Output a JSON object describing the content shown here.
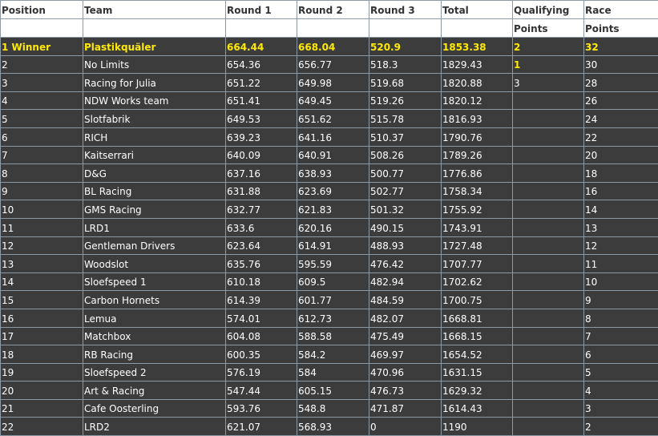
{
  "headers": {
    "position": "Position",
    "team": "Team",
    "round1": "Round 1",
    "round2": "Round 2",
    "round3": "Round 3",
    "total": "Total",
    "qualifying_top": "Qualifying",
    "qualifying_bottom": "Points",
    "race_top": "Race",
    "race_bottom": "Points"
  },
  "rows": [
    {
      "pos": "1  Winner",
      "team": "Plastikquäler",
      "r1": "664.44",
      "r2": "668.04",
      "r3": "520.9",
      "total": "1853.38",
      "qual": "2",
      "race": "32"
    },
    {
      "pos": "2",
      "team": "No Limits",
      "r1": "654.36",
      "r2": "656.77",
      "r3": "518.3",
      "total": "1829.43",
      "qual": "1",
      "race": "30"
    },
    {
      "pos": "3",
      "team": "Racing for Julia",
      "r1": "651.22",
      "r2": "649.98",
      "r3": "519.68",
      "total": "1820.88",
      "qual": "3",
      "race": "28"
    },
    {
      "pos": "4",
      "team": "NDW Works team",
      "r1": "651.41",
      "r2": "649.45",
      "r3": "519.26",
      "total": "1820.12",
      "qual": "",
      "race": "26"
    },
    {
      "pos": "5",
      "team": "Slotfabrik",
      "r1": "649.53",
      "r2": "651.62",
      "r3": "515.78",
      "total": "1816.93",
      "qual": "",
      "race": "24"
    },
    {
      "pos": "6",
      "team": "RICH",
      "r1": "639.23",
      "r2": "641.16",
      "r3": "510.37",
      "total": "1790.76",
      "qual": "",
      "race": "22"
    },
    {
      "pos": "7",
      "team": "Kaitserrari",
      "r1": "640.09",
      "r2": "640.91",
      "r3": "508.26",
      "total": "1789.26",
      "qual": "",
      "race": "20"
    },
    {
      "pos": "8",
      "team": "D&G",
      "r1": "637.16",
      "r2": "638.93",
      "r3": "500.77",
      "total": "1776.86",
      "qual": "",
      "race": "18"
    },
    {
      "pos": "9",
      "team": "BL Racing",
      "r1": "631.88",
      "r2": "623.69",
      "r3": "502.77",
      "total": "1758.34",
      "qual": "",
      "race": "16"
    },
    {
      "pos": "10",
      "team": "GMS Racing",
      "r1": "632.77",
      "r2": "621.83",
      "r3": "501.32",
      "total": "1755.92",
      "qual": "",
      "race": "14"
    },
    {
      "pos": "11",
      "team": "LRD1",
      "r1": "633.6",
      "r2": "620.16",
      "r3": "490.15",
      "total": "1743.91",
      "qual": "",
      "race": "13"
    },
    {
      "pos": "12",
      "team": "Gentleman Drivers",
      "r1": "623.64",
      "r2": "614.91",
      "r3": "488.93",
      "total": "1727.48",
      "qual": "",
      "race": "12"
    },
    {
      "pos": "13",
      "team": "Woodslot",
      "r1": "635.76",
      "r2": "595.59",
      "r3": "476.42",
      "total": "1707.77",
      "qual": "",
      "race": "11"
    },
    {
      "pos": "14",
      "team": "Sloefspeed 1",
      "r1": "610.18",
      "r2": "609.5",
      "r3": "482.94",
      "total": "1702.62",
      "qual": "",
      "race": "10"
    },
    {
      "pos": "15",
      "team": "Carbon Hornets",
      "r1": "614.39",
      "r2": "601.77",
      "r3": "484.59",
      "total": "1700.75",
      "qual": "",
      "race": "9"
    },
    {
      "pos": "16",
      "team": "Lemua",
      "r1": "574.01",
      "r2": "612.73",
      "r3": "482.07",
      "total": "1668.81",
      "qual": "",
      "race": "8"
    },
    {
      "pos": "17",
      "team": "Matchbox",
      "r1": "604.08",
      "r2": "588.58",
      "r3": "475.49",
      "total": "1668.15",
      "qual": "",
      "race": "7"
    },
    {
      "pos": "18",
      "team": "RB Racing",
      "r1": "600.35",
      "r2": "584.2",
      "r3": "469.97",
      "total": "1654.52",
      "qual": "",
      "race": "6"
    },
    {
      "pos": "19",
      "team": "Sloefspeed 2",
      "r1": "576.19",
      "r2": "584",
      "r3": "470.96",
      "total": "1631.15",
      "qual": "",
      "race": "5"
    },
    {
      "pos": "20",
      "team": "Art & Racing",
      "r1": "547.44",
      "r2": "605.15",
      "r3": "476.73",
      "total": "1629.32",
      "qual": "",
      "race": "4"
    },
    {
      "pos": "21",
      "team": "Cafe Oosterling",
      "r1": "593.76",
      "r2": "548.8",
      "r3": "471.87",
      "total": "1614.43",
      "qual": "",
      "race": "3"
    },
    {
      "pos": "22",
      "team": "LRD2",
      "r1": "621.07",
      "r2": "568.93",
      "r3": "0",
      "total": "1190",
      "qual": "",
      "race": "2"
    }
  ],
  "colors": {
    "background": "#3c3c3c",
    "highlight": "#ffea00",
    "header_background": "#ffffff",
    "grid": "#8a9aa6"
  }
}
